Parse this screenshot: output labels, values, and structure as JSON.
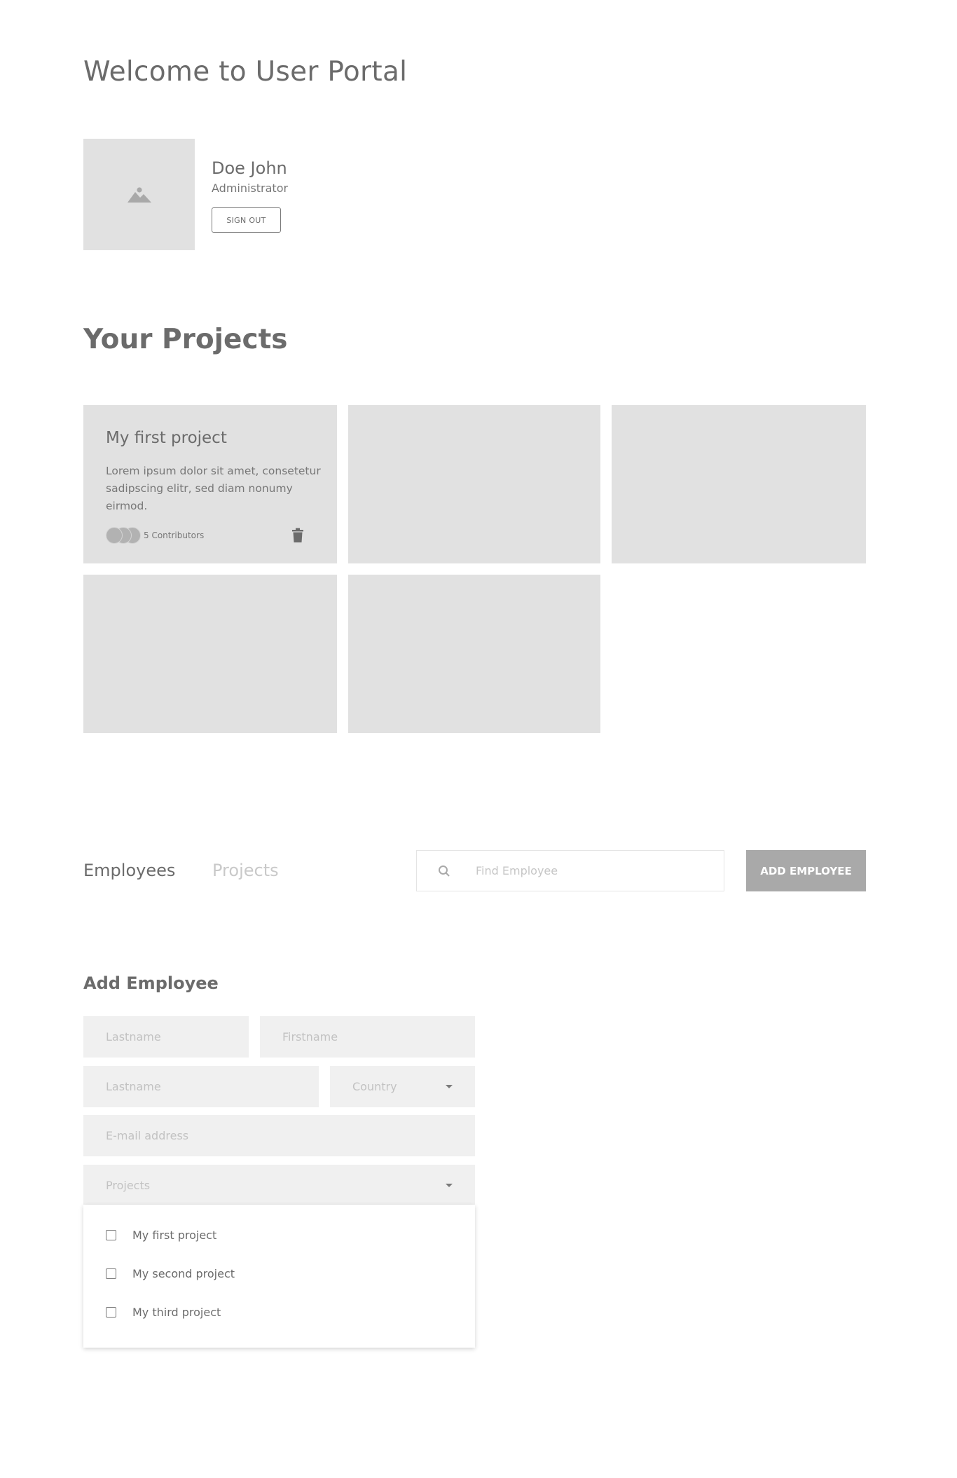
{
  "header": {
    "title": "Welcome to User Portal"
  },
  "user": {
    "name": "Doe John",
    "role": "Administrator",
    "sign_out_label": "SIGN OUT"
  },
  "projects": {
    "title": "Your Projects",
    "first": {
      "title": "My first project",
      "description": "Lorem ipsum dolor sit amet, consetetur sadipscing elitr, sed diam nonumy eirmod.",
      "contributors_label": "5 Contributors"
    }
  },
  "tabs": {
    "employees": "Employees",
    "projects": "Projects"
  },
  "search": {
    "placeholder": "Find Employee"
  },
  "add_employee_button": "ADD EMPLOYEE",
  "form": {
    "title": "Add Employee",
    "lastname_placeholder": "Lastname",
    "firstname_placeholder": "Firstname",
    "lastname2_placeholder": "Lastname",
    "country_placeholder": "Country",
    "email_placeholder": "E-mail address",
    "projects_placeholder": "Projects",
    "project_options": [
      "My first project",
      "My second project",
      "My third project"
    ]
  },
  "colors": {
    "card": "#e1e1e1",
    "field": "#f0f0f0",
    "button": "#a9a9a9",
    "text": "#6b6b6b"
  }
}
